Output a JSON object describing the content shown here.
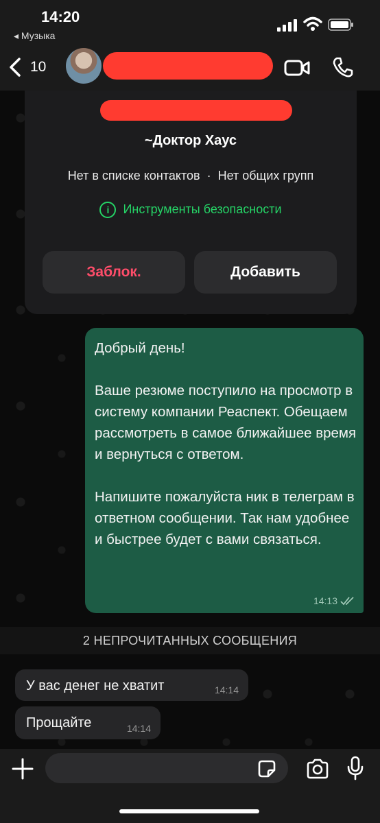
{
  "status_bar": {
    "time": "14:20",
    "back_app": "◂ Музыка"
  },
  "header": {
    "back_count": "10"
  },
  "contact_card": {
    "nickname": "~Доктор Хаус",
    "not_in_contacts": "Нет в списке контактов",
    "separator": "·",
    "no_common_groups": "Нет общих групп",
    "safety_tools": "Инструменты безопасности",
    "block_label": "Заблок.",
    "add_label": "Добавить"
  },
  "messages": {
    "outgoing": {
      "text": "Добрый день!\n\nВаше резюме поступило на просмотр в систему компании Реаспект. Обещаем рассмотреть в самое ближайшее время и вернуться с ответом.\n\nНапишите пожалуйста ник в телеграм в ответном сообщении. Так нам удобнее и быстрее будет с вами связаться.",
      "time": "14:13"
    },
    "unread_divider": "2 НЕПРОЧИТАННЫХ СООБЩЕНИЯ",
    "incoming": [
      {
        "text": "У вас денег не хватит",
        "time": "14:14"
      },
      {
        "text": "Прощайте",
        "time": "14:14"
      }
    ]
  },
  "input": {
    "placeholder": ""
  },
  "colors": {
    "accent_green": "#25d366",
    "outgoing_bubble": "#1d5c45",
    "redaction": "#ff3b30",
    "block_red": "#ff4d6a"
  }
}
